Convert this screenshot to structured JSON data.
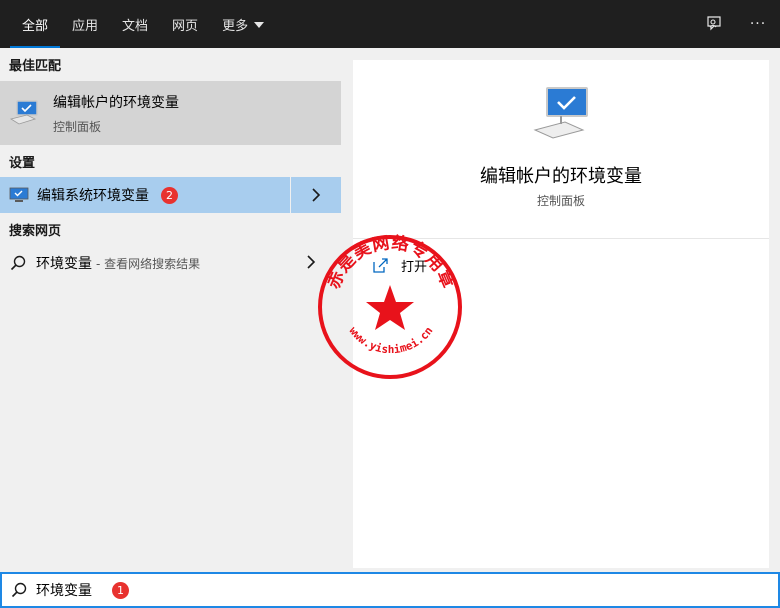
{
  "tabs": [
    {
      "label": "全部",
      "active": true
    },
    {
      "label": "应用",
      "active": false
    },
    {
      "label": "文档",
      "active": false
    },
    {
      "label": "网页",
      "active": false
    },
    {
      "label": "更多",
      "active": false,
      "has_dropdown": true
    }
  ],
  "top_icons": [
    "feedback-icon",
    "more-icon"
  ],
  "more_label": "···",
  "sections": {
    "best_match_label": "最佳匹配",
    "settings_label": "设置",
    "web_label": "搜索网页"
  },
  "best_match": {
    "title": "编辑帐户的环境变量",
    "subtitle": "控制面板",
    "icon": "monitor-icon"
  },
  "setting_item": {
    "label": "编辑系统环境变量",
    "badge": "2",
    "icon": "monitor-icon"
  },
  "web_item": {
    "label": "环境变量",
    "sub": "- 查看网络搜索结果"
  },
  "preview": {
    "title": "编辑帐户的环境变量",
    "subtitle": "控制面板",
    "open_label": "打开"
  },
  "search": {
    "value": "环境变量",
    "badge": "1"
  },
  "seal": {
    "top_text": "赤是美网络专用章",
    "bottom_text": "www.yishimei.cn",
    "color": "#e8121b"
  },
  "colors": {
    "topbar": "#1f1f1f",
    "accent": "#0078d7",
    "selected_row": "#a8cdee",
    "best_match_bg": "#d4d4d4",
    "badge": "#e8322f"
  }
}
